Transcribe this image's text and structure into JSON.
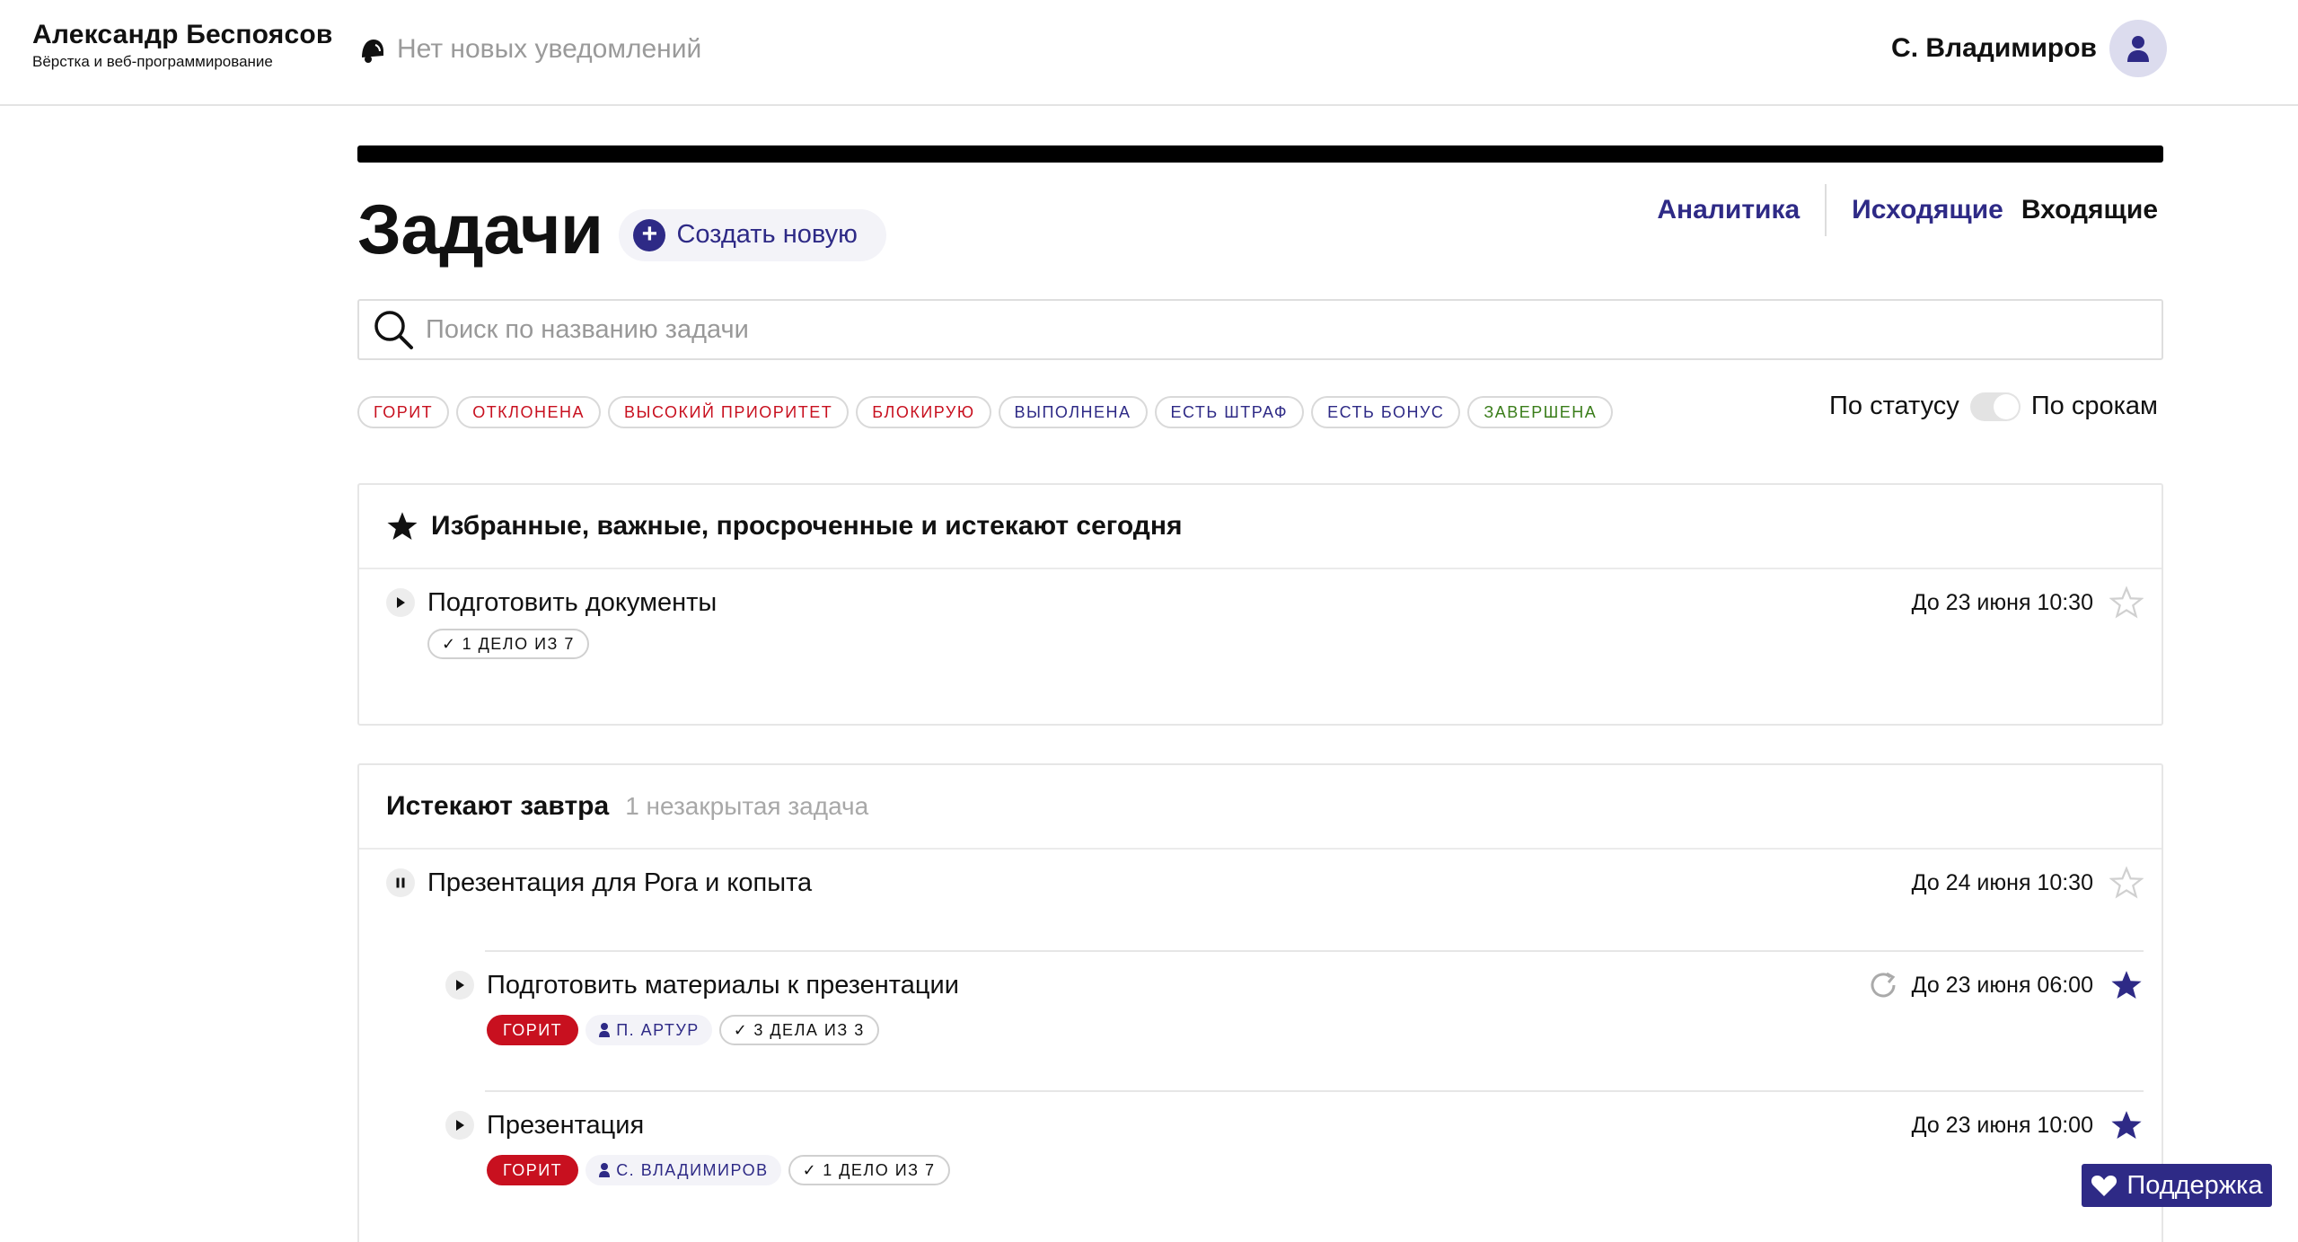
{
  "header": {
    "brand_name": "Александр Беспоясов",
    "brand_sub": "Вёрстка и веб-программирование",
    "notifications": "Нет новых уведомлений",
    "user_name": "С. Владимиров"
  },
  "page": {
    "title": "Задачи",
    "create_label": "Создать новую",
    "nav": {
      "analytics": "Аналитика",
      "outgoing": "Исходящие",
      "incoming": "Входящие"
    },
    "search_placeholder": "Поиск по названию задачи",
    "toggle": {
      "left": "По статусу",
      "right": "По срокам"
    }
  },
  "filters": [
    {
      "label": "Горит",
      "color": "#c8101f"
    },
    {
      "label": "Отклонена",
      "color": "#c8101f"
    },
    {
      "label": "Высокий приоритет",
      "color": "#c8101f"
    },
    {
      "label": "Блокирую",
      "color": "#c8101f"
    },
    {
      "label": "Выполнена",
      "color": "#2e2a86"
    },
    {
      "label": "Есть штраф",
      "color": "#2e2a86"
    },
    {
      "label": "Есть бонус",
      "color": "#2e2a86"
    },
    {
      "label": "Завершена",
      "color": "#3a7d1a"
    }
  ],
  "sections": [
    {
      "title": "Избранные, важные, просроченные и истекают сегодня",
      "tasks": [
        {
          "title": "Подготовить документы",
          "due": "До 23 июня 10:30",
          "starred": false,
          "state": "play",
          "checklist": "1 дело из 7"
        }
      ]
    },
    {
      "title": "Истекают завтра",
      "subtitle": "1 незакрытая задача",
      "tasks": [
        {
          "title": "Презентация для Рога и копыта",
          "due": "До 24 июня 10:30",
          "starred": false,
          "state": "pause"
        },
        {
          "title": "Подготовить материалы к презентации",
          "due": "До 23 июня 06:00",
          "starred": true,
          "state": "play",
          "recurring": true,
          "hot": "Горит",
          "person": "П. Артур",
          "checklist": "3 дела из 3"
        },
        {
          "title": "Презентация",
          "due": "До 23 июня 10:00",
          "starred": true,
          "state": "play",
          "hot": "Горит",
          "person": "С. Владимиров",
          "checklist": "1 дело из 7"
        }
      ]
    }
  ],
  "support_label": "Поддержка",
  "colors": {
    "accent": "#2e2a86",
    "hot": "#c8101f",
    "done": "#3a7d1a"
  }
}
